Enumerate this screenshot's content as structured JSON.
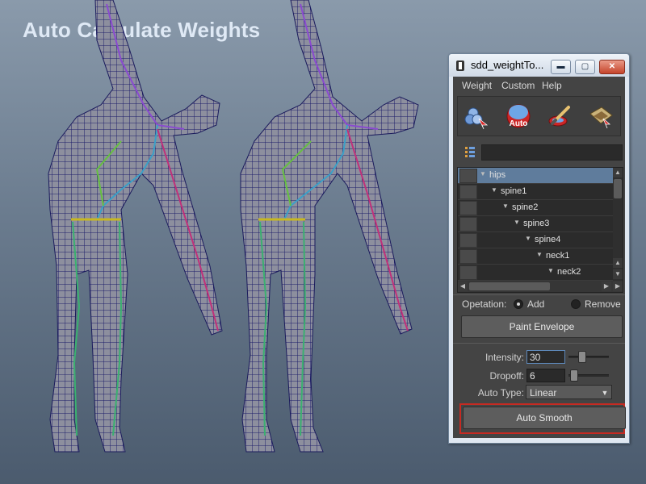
{
  "headline": "Auto Calculate Weights",
  "window": {
    "title": "sdd_weightTo...",
    "buttons": {
      "minimize": "▬",
      "maximize": "▢",
      "close": "✕"
    }
  },
  "menubar": {
    "items": [
      "Weight",
      "Custom",
      "Help"
    ]
  },
  "toolbar": {
    "auto_label": "Auto",
    "icons": [
      "paint-weights-icon",
      "auto-weights-icon",
      "brush-icon",
      "map-icon"
    ]
  },
  "joint_tree": {
    "rows": [
      {
        "name": "hips",
        "selected": true
      },
      {
        "name": "spine1",
        "selected": false
      },
      {
        "name": "spine2",
        "selected": false
      },
      {
        "name": "spine3",
        "selected": false
      },
      {
        "name": "spine4",
        "selected": false
      },
      {
        "name": "neck1",
        "selected": false
      },
      {
        "name": "neck2",
        "selected": false
      }
    ]
  },
  "operation": {
    "label": "Opetation:",
    "options": [
      {
        "label": "Add",
        "selected": true
      },
      {
        "label": "Remove",
        "selected": false
      }
    ]
  },
  "paint_envelope_label": "Paint Envelope",
  "intensity": {
    "label": "Intensity:",
    "value": "30"
  },
  "dropoff": {
    "label": "Dropoff:",
    "value": "6"
  },
  "auto_type": {
    "label": "Auto Type:",
    "value": "Linear"
  },
  "auto_smooth_label": "Auto Smooth",
  "colors": {
    "accent_selection": "#5f7c9c",
    "highlight_box": "#c62a22",
    "panel": "#444444"
  }
}
